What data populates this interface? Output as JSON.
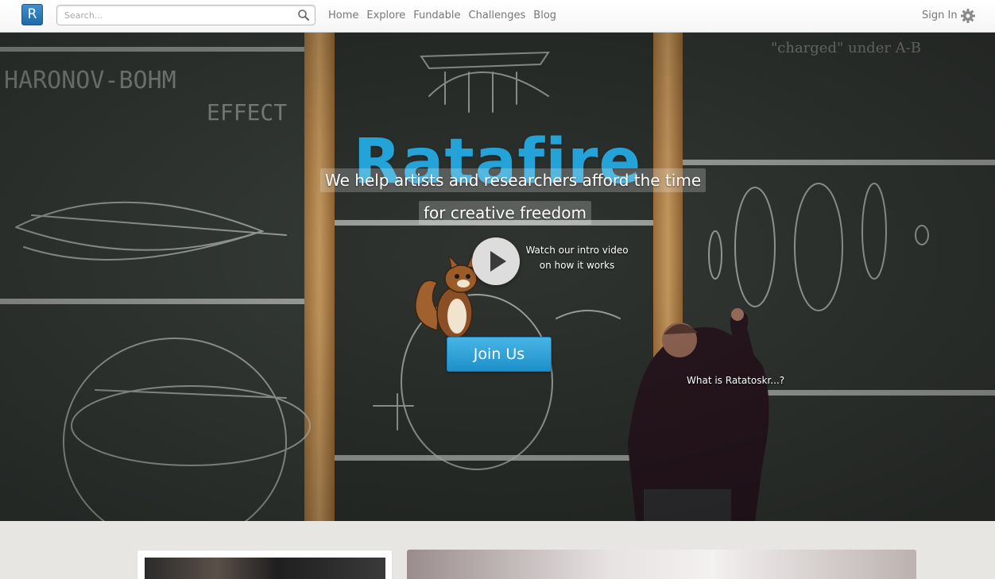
{
  "header": {
    "logo_letter": "R",
    "search": {
      "placeholder": "Search...",
      "value": ""
    },
    "nav": [
      "Home",
      "Explore",
      "Fundable",
      "Challenges",
      "Blog"
    ],
    "sign_in": "Sign In"
  },
  "hero": {
    "title": "Ratafire",
    "tagline_line1": "We help artists and researchers afford the time",
    "tagline_line2": "for creative freedom",
    "video_line1": "Watch our intro video",
    "video_line2": "on how it works",
    "join_button": "Join Us",
    "what_is_link": "What is Ratatoskr...?"
  },
  "colors": {
    "brand_blue": "#24a3d8",
    "join_button": "#2a9fd6",
    "chalkboard": "#323733",
    "wood_frame": "#c89a5c"
  },
  "icons": [
    "search-icon",
    "gear-icon",
    "play-icon",
    "squirrel-mascot"
  ]
}
